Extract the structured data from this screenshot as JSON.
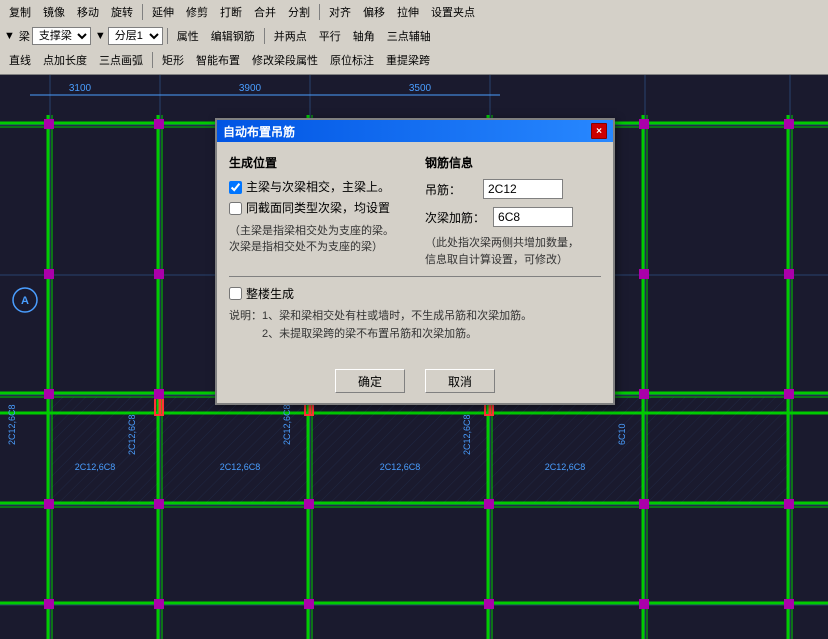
{
  "toolbar": {
    "row1": {
      "items": [
        "复制",
        "镜像",
        "移动",
        "旋转",
        "延伸",
        "修剪",
        "打断",
        "合并",
        "分割",
        "对齐",
        "偏移",
        "拉伸",
        "设置夹点"
      ]
    },
    "row2": {
      "layer_label": "梁",
      "layer_type": "支撑梁",
      "layer_num": "分层1",
      "items": [
        "属性",
        "编辑钢筋",
        "并两点",
        "平行",
        "轴角",
        "三点辅轴"
      ]
    },
    "row3": {
      "items": [
        "直线",
        "点加长度",
        "三点画弧",
        "矩形",
        "智能布置",
        "修改梁段属性",
        "原位标注",
        "重提梁跨"
      ]
    }
  },
  "dimensions": {
    "d1": "3100",
    "d2": "3900",
    "d3": "3500"
  },
  "dialog": {
    "title": "自动布置吊筋",
    "close_btn": "×",
    "sections": {
      "left": {
        "header": "生成位置",
        "checkbox1": {
          "checked": true,
          "label": "主梁与次梁相交，主梁上。"
        },
        "checkbox2": {
          "checked": false,
          "label": "同截面同类型次梁，均设置"
        },
        "note1": "（主梁是指梁相交处为支座的梁。",
        "note2": "次梁是指相交处不为支座的梁）"
      },
      "right": {
        "header": "钢筋信息",
        "field1_label": "吊筋：",
        "field1_value": "2C12",
        "field2_label": "次梁加筋：",
        "field2_value": "6C8",
        "rebar_note1": "（此处指次梁两侧共增加数量，",
        "rebar_note2": "信息取自计算设置，可修改）"
      }
    },
    "whole_floor": {
      "checkbox_checked": false,
      "label": "整楼生成"
    },
    "description": {
      "line1": "说明：1、梁和梁相交处有柱或墙时，不生成吊筋和次梁加筋。",
      "line2": "　　　2、未提取梁跨的梁不布置吊筋和次梁加筋。"
    },
    "footer": {
      "confirm": "确定",
      "cancel": "取消"
    }
  },
  "cad_labels": {
    "beam_labels": [
      "2C12,6C8",
      "2C12,6C8",
      "2C12,6C8",
      "2C12,6C8"
    ],
    "vertical_labels": [
      "2C12,6C8",
      "2C12,6C8",
      "6C10"
    ],
    "letter_a": "A"
  }
}
